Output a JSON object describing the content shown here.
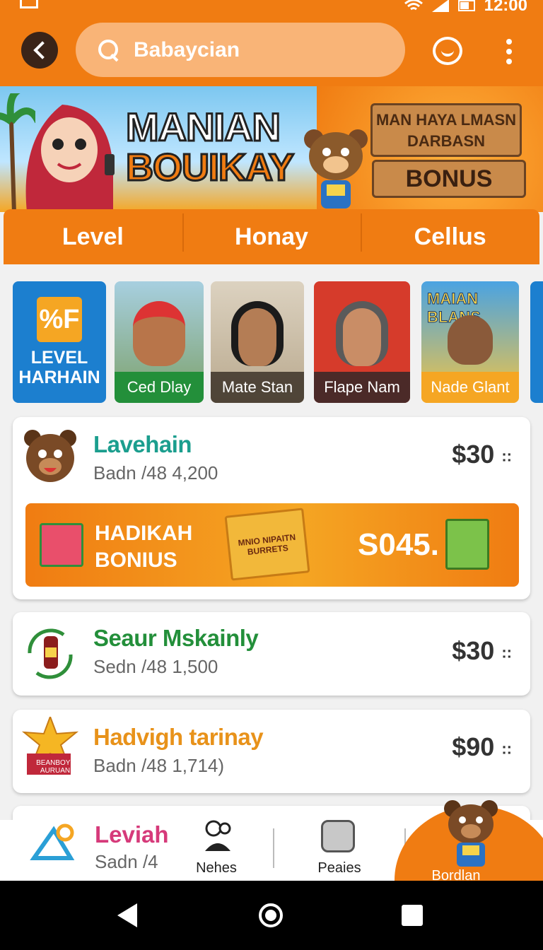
{
  "status_bar": {
    "time": "12:00"
  },
  "header": {
    "search": "Babaycian"
  },
  "banner": {
    "title": "MANIAN",
    "subtitle": "BOUIKAY",
    "sign_top": "MAN HAYA LMASN DARBASN",
    "sign_bottom": "BONUS"
  },
  "tabs": [
    {
      "label": "Level"
    },
    {
      "label": "Honay"
    },
    {
      "label": "Cellus"
    }
  ],
  "stories": [
    {
      "label": "LEVEL HARHAIN",
      "icon_text": "%F"
    },
    {
      "label": "Ced Dlay"
    },
    {
      "label": "Mate Stan"
    },
    {
      "label": "Flape Nam"
    },
    {
      "label": "Nade Glant",
      "art_text": "MAIAN BLANS"
    }
  ],
  "rows": [
    {
      "title": "Lavehain",
      "sub": "Badn /48 4,200",
      "price": "$30",
      "color": "#1b9e8e"
    },
    {
      "title": "Seaur Mskainly",
      "sub": "Sedn /48 1,500",
      "price": "$30",
      "color": "#238f3a"
    },
    {
      "title": "Hadvigh tarinay",
      "sub": "Badn /48 1,714)",
      "price": "$90",
      "color": "#e8921a",
      "badge": "BEANBOY I AURUAN"
    },
    {
      "title": "Leviah",
      "sub": "Sadn /4",
      "color": "#d63a7a"
    }
  ],
  "bonus": {
    "label_line1": "HADIKAH",
    "label_line2": "BONIUS",
    "amount": "S045.",
    "box_text": "MNIO NIPAITN BURRETS"
  },
  "bottom_nav": [
    {
      "label": "Nehes"
    },
    {
      "label": "Peaies"
    },
    {
      "label": "Bordlan"
    }
  ],
  "price_suffix": "::"
}
